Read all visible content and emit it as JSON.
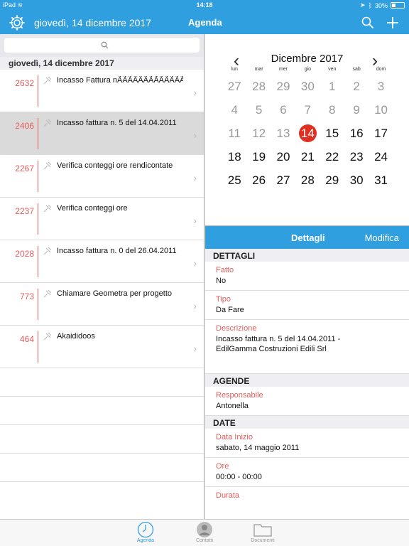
{
  "status": {
    "device": "iPad",
    "time": "14:18",
    "battery": "30%"
  },
  "nav": {
    "date": "giovedì, 14 dicembre 2017",
    "title": "Agenda"
  },
  "list": {
    "section": "giovedì, 14 dicembre 2017",
    "items": [
      {
        "num": "2632",
        "title": "Incasso Fattura nÃÃÃÃÃÃÃÃÃÃÃÃÃÃÃÃÃ"
      },
      {
        "num": "2406",
        "title": "Incasso fattura n. 5 del 14.04.2011"
      },
      {
        "num": "2267",
        "title": "Verifica conteggi ore rendicontate"
      },
      {
        "num": "2237",
        "title": "Verifica conteggi ore"
      },
      {
        "num": "2028",
        "title": "Incasso fattura n. 0 del 26.04.2011"
      },
      {
        "num": "773",
        "title": "Chiamare Geometra per progetto"
      },
      {
        "num": "464",
        "title": "Akaididoos"
      }
    ]
  },
  "calendar": {
    "month": "Dicembre 2017",
    "dows": [
      "lun",
      "mar",
      "mer",
      "gio",
      "ven",
      "sab",
      "dom"
    ],
    "weeks": [
      [
        "27",
        "28",
        "29",
        "30",
        "1",
        "2",
        "3"
      ],
      [
        "4",
        "5",
        "6",
        "7",
        "8",
        "9",
        "10"
      ],
      [
        "11",
        "12",
        "13",
        "14",
        "15",
        "16",
        "17"
      ],
      [
        "18",
        "19",
        "20",
        "21",
        "22",
        "23",
        "24"
      ],
      [
        "25",
        "26",
        "27",
        "28",
        "29",
        "30",
        "31"
      ]
    ]
  },
  "details": {
    "title": "Dettagli",
    "edit": "Modifica",
    "g1": "DETTAGLI",
    "fatto_label": "Fatto",
    "fatto_value": "No",
    "tipo_label": "Tipo",
    "tipo_value": "Da Fare",
    "descr_label": "Descrizione",
    "descr_value": "Incasso fattura n. 5 del 14.04.2011 - EdilGamma Costruzioni Edili Srl",
    "g2": "AGENDE",
    "resp_label": "Responsabile",
    "resp_value": "Antonella",
    "g3": "DATE",
    "inizio_label": "Data Inizio",
    "inizio_value": "sabato, 14 maggio 2011",
    "ore_label": "Ore",
    "ore_value": "00:00 - 00:00",
    "durata_label": "Durata"
  },
  "tabs": {
    "agenda": "Agenda",
    "contatti": "Contatti",
    "documenti": "Documenti"
  },
  "colors": {
    "accent": "#2f9fe0",
    "number": "#e85b5b",
    "today": "#e02e20"
  }
}
